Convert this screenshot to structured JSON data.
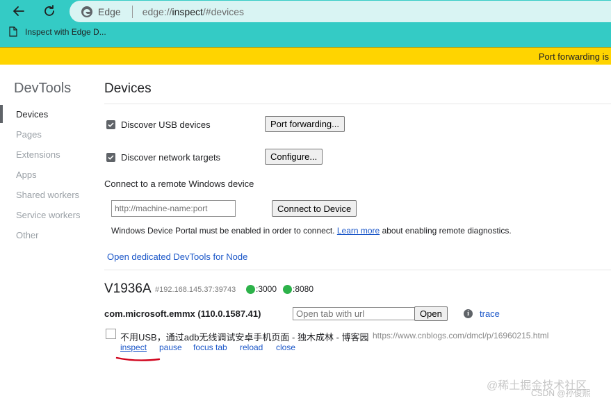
{
  "browser": {
    "brand": "Edge",
    "url_scheme": "edge://",
    "url_host": "inspect",
    "url_rest": "/#devices",
    "bookmark_label": "Inspect with Edge D...",
    "banner_text": "Port forwarding is"
  },
  "sidebar": {
    "title": "DevTools",
    "items": [
      {
        "label": "Devices",
        "active": true
      },
      {
        "label": "Pages"
      },
      {
        "label": "Extensions"
      },
      {
        "label": "Apps"
      },
      {
        "label": "Shared workers"
      },
      {
        "label": "Service workers"
      },
      {
        "label": "Other"
      }
    ]
  },
  "main": {
    "title": "Devices",
    "discover_usb_label": "Discover USB devices",
    "port_forwarding_button": "Port forwarding...",
    "discover_network_label": "Discover network targets",
    "configure_button": "Configure...",
    "remote_heading": "Connect to a remote Windows device",
    "remote_input_placeholder": "http://machine-name:port",
    "connect_button": "Connect to Device",
    "portal_note_before": "Windows Device Portal must be enabled in order to connect.",
    "portal_learn_more": "Learn more",
    "portal_note_after": "about enabling remote diagnostics.",
    "open_node_link": "Open dedicated DevTools for Node"
  },
  "device": {
    "name": "V1936A",
    "serial": "#192.168.145.37:39743",
    "ports": [
      ":3000",
      ":8080"
    ],
    "package": "com.microsoft.emmx (110.0.1587.41)",
    "open_tab_placeholder": "Open tab with url",
    "open_button": "Open",
    "trace_link": "trace",
    "page_title": "不用USB，通过adb无线调试安卓手机页面 - 独木成林 - 博客园",
    "page_url": "https://www.cnblogs.com/dmcl/p/16960215.html",
    "actions": [
      "inspect",
      "pause",
      "focus tab",
      "reload",
      "close"
    ]
  },
  "watermark": {
    "line1": "@稀土掘金技术社区",
    "line2": "CSDN @孙俊熙"
  },
  "colors": {
    "toolbar": "#34cbc5",
    "banner": "#ffd400",
    "link": "#1a56c8",
    "status_green": "#2db24a",
    "annotation_red": "#d0021b"
  }
}
